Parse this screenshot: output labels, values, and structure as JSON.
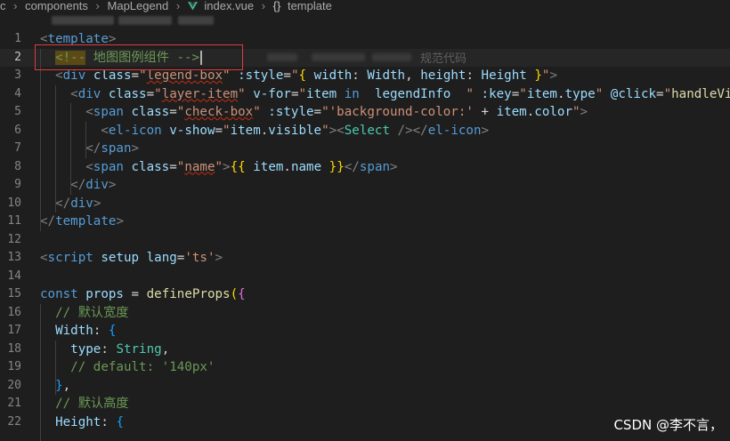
{
  "breadcrumb": {
    "items": [
      "c",
      "components",
      "MapLegend",
      "index.vue",
      "template"
    ],
    "vue_icon": "vue-logo-icon",
    "symbol_icon": "braces-icon"
  },
  "annotation": "规范代码",
  "watermark": "CSDN @李不言，",
  "colors": {
    "background": "#1e1e1e",
    "highlight_box": "#e03b3b",
    "comment_highlight": "#5c4a16"
  },
  "editor": {
    "current_line": 2,
    "lines": [
      {
        "n": "1",
        "tokens": [
          {
            "t": "<",
            "c": "t-tag"
          },
          {
            "t": "template",
            "c": "t-tn"
          },
          {
            "t": ">",
            "c": "t-tag"
          }
        ]
      },
      {
        "n": "2",
        "tokens": [
          {
            "t": "  "
          },
          {
            "t": "<!--",
            "c": "cmt-hl"
          },
          {
            "t": " 地图图例组件 -->",
            "c": "t-cmt"
          }
        ]
      },
      {
        "n": "3",
        "tokens": [
          {
            "t": "  "
          },
          {
            "t": "<",
            "c": "t-tag"
          },
          {
            "t": "div",
            "c": "t-tn"
          },
          {
            "t": " "
          },
          {
            "t": "class",
            "c": "t-attr"
          },
          {
            "t": "="
          },
          {
            "t": "\"",
            "c": "t-str"
          },
          {
            "t": "legend-box",
            "c": "t-str u-red"
          },
          {
            "t": "\"",
            "c": "t-str"
          },
          {
            "t": " "
          },
          {
            "t": ":style",
            "c": "t-attr"
          },
          {
            "t": "="
          },
          {
            "t": "\"",
            "c": "t-str"
          },
          {
            "t": "{",
            "c": "t-br1"
          },
          {
            "t": " "
          },
          {
            "t": "width",
            "c": "t-var"
          },
          {
            "t": ": "
          },
          {
            "t": "Width",
            "c": "t-var"
          },
          {
            "t": ", "
          },
          {
            "t": "height",
            "c": "t-var"
          },
          {
            "t": ": "
          },
          {
            "t": "Height",
            "c": "t-var"
          },
          {
            "t": " "
          },
          {
            "t": "}",
            "c": "t-br1"
          },
          {
            "t": "\"",
            "c": "t-str"
          },
          {
            "t": ">",
            "c": "t-tag"
          }
        ]
      },
      {
        "n": "4",
        "tokens": [
          {
            "t": "    "
          },
          {
            "t": "<",
            "c": "t-tag"
          },
          {
            "t": "div",
            "c": "t-tn"
          },
          {
            "t": " "
          },
          {
            "t": "class",
            "c": "t-attr"
          },
          {
            "t": "="
          },
          {
            "t": "\"",
            "c": "t-str"
          },
          {
            "t": "layer-item",
            "c": "t-str u-red"
          },
          {
            "t": "\"",
            "c": "t-str"
          },
          {
            "t": " "
          },
          {
            "t": "v-for",
            "c": "t-attr"
          },
          {
            "t": "="
          },
          {
            "t": "\"",
            "c": "t-str"
          },
          {
            "t": "item",
            "c": "t-var"
          },
          {
            "t": " "
          },
          {
            "t": "in",
            "c": "t-kw"
          },
          {
            "t": "  "
          },
          {
            "t": "legendInfo",
            "c": "t-var"
          },
          {
            "t": "  "
          },
          {
            "t": "\"",
            "c": "t-str"
          },
          {
            "t": " "
          },
          {
            "t": ":key",
            "c": "t-attr"
          },
          {
            "t": "="
          },
          {
            "t": "\"",
            "c": "t-str"
          },
          {
            "t": "item",
            "c": "t-var"
          },
          {
            "t": "."
          },
          {
            "t": "type",
            "c": "t-var"
          },
          {
            "t": "\"",
            "c": "t-str"
          },
          {
            "t": " "
          },
          {
            "t": "@click",
            "c": "t-attr"
          },
          {
            "t": "="
          },
          {
            "t": "\"",
            "c": "t-str"
          },
          {
            "t": "handleVisib",
            "c": "t-fn"
          }
        ]
      },
      {
        "n": "5",
        "tokens": [
          {
            "t": "      "
          },
          {
            "t": "<",
            "c": "t-tag"
          },
          {
            "t": "span",
            "c": "t-tn"
          },
          {
            "t": " "
          },
          {
            "t": "class",
            "c": "t-attr"
          },
          {
            "t": "="
          },
          {
            "t": "\"",
            "c": "t-str"
          },
          {
            "t": "check-box",
            "c": "t-str u-red"
          },
          {
            "t": "\"",
            "c": "t-str"
          },
          {
            "t": " "
          },
          {
            "t": ":style",
            "c": "t-attr"
          },
          {
            "t": "="
          },
          {
            "t": "\"",
            "c": "t-str"
          },
          {
            "t": "'background-color:'",
            "c": "t-str"
          },
          {
            "t": " + "
          },
          {
            "t": "item",
            "c": "t-var"
          },
          {
            "t": "."
          },
          {
            "t": "color",
            "c": "t-var"
          },
          {
            "t": "\"",
            "c": "t-str"
          },
          {
            "t": ">",
            "c": "t-tag"
          }
        ]
      },
      {
        "n": "6",
        "tokens": [
          {
            "t": "        "
          },
          {
            "t": "<",
            "c": "t-tag"
          },
          {
            "t": "el-icon",
            "c": "t-tn"
          },
          {
            "t": " "
          },
          {
            "t": "v-show",
            "c": "t-attr"
          },
          {
            "t": "="
          },
          {
            "t": "\"",
            "c": "t-str"
          },
          {
            "t": "item",
            "c": "t-var"
          },
          {
            "t": "."
          },
          {
            "t": "visible",
            "c": "t-var"
          },
          {
            "t": "\"",
            "c": "t-str"
          },
          {
            "t": "><",
            "c": "t-tag"
          },
          {
            "t": "Select",
            "c": "t-type"
          },
          {
            "t": " "
          },
          {
            "t": "/></",
            "c": "t-tag"
          },
          {
            "t": "el-icon",
            "c": "t-tn"
          },
          {
            "t": ">",
            "c": "t-tag"
          }
        ]
      },
      {
        "n": "7",
        "tokens": [
          {
            "t": "      "
          },
          {
            "t": "</",
            "c": "t-tag"
          },
          {
            "t": "span",
            "c": "t-tn"
          },
          {
            "t": ">",
            "c": "t-tag"
          }
        ]
      },
      {
        "n": "8",
        "tokens": [
          {
            "t": "      "
          },
          {
            "t": "<",
            "c": "t-tag"
          },
          {
            "t": "span",
            "c": "t-tn"
          },
          {
            "t": " "
          },
          {
            "t": "class",
            "c": "t-attr"
          },
          {
            "t": "="
          },
          {
            "t": "\"",
            "c": "t-str"
          },
          {
            "t": "name",
            "c": "t-str u-red"
          },
          {
            "t": "\"",
            "c": "t-str"
          },
          {
            "t": ">",
            "c": "t-tag"
          },
          {
            "t": "{{",
            "c": "t-br1"
          },
          {
            "t": " "
          },
          {
            "t": "item",
            "c": "t-var"
          },
          {
            "t": "."
          },
          {
            "t": "name",
            "c": "t-var"
          },
          {
            "t": " "
          },
          {
            "t": "}}",
            "c": "t-br1"
          },
          {
            "t": "</",
            "c": "t-tag"
          },
          {
            "t": "span",
            "c": "t-tn"
          },
          {
            "t": ">",
            "c": "t-tag"
          }
        ]
      },
      {
        "n": "9",
        "tokens": [
          {
            "t": "    "
          },
          {
            "t": "</",
            "c": "t-tag"
          },
          {
            "t": "div",
            "c": "t-tn"
          },
          {
            "t": ">",
            "c": "t-tag"
          }
        ]
      },
      {
        "n": "10",
        "tokens": [
          {
            "t": "  "
          },
          {
            "t": "</",
            "c": "t-tag"
          },
          {
            "t": "div",
            "c": "t-tn"
          },
          {
            "t": ">",
            "c": "t-tag"
          }
        ]
      },
      {
        "n": "11",
        "tokens": [
          {
            "t": "</",
            "c": "t-tag"
          },
          {
            "t": "template",
            "c": "t-tn"
          },
          {
            "t": ">",
            "c": "t-tag"
          }
        ]
      },
      {
        "n": "12",
        "tokens": []
      },
      {
        "n": "13",
        "tokens": [
          {
            "t": "<",
            "c": "t-tag"
          },
          {
            "t": "script",
            "c": "t-tn"
          },
          {
            "t": " "
          },
          {
            "t": "setup",
            "c": "t-attr"
          },
          {
            "t": " "
          },
          {
            "t": "lang",
            "c": "t-attr"
          },
          {
            "t": "="
          },
          {
            "t": "'ts'",
            "c": "t-str"
          },
          {
            "t": ">",
            "c": "t-tag"
          }
        ]
      },
      {
        "n": "14",
        "tokens": []
      },
      {
        "n": "15",
        "tokens": [
          {
            "t": "const",
            "c": "t-kw"
          },
          {
            "t": " "
          },
          {
            "t": "props",
            "c": "t-var"
          },
          {
            "t": " = "
          },
          {
            "t": "defineProps",
            "c": "t-fn"
          },
          {
            "t": "(",
            "c": "t-br1"
          },
          {
            "t": "{",
            "c": "t-br2"
          }
        ]
      },
      {
        "n": "16",
        "tokens": [
          {
            "t": "  "
          },
          {
            "t": "// 默认宽度",
            "c": "t-cmt"
          }
        ]
      },
      {
        "n": "17",
        "tokens": [
          {
            "t": "  "
          },
          {
            "t": "Width",
            "c": "t-var"
          },
          {
            "t": ": "
          },
          {
            "t": "{",
            "c": "t-br3"
          }
        ]
      },
      {
        "n": "18",
        "tokens": [
          {
            "t": "    "
          },
          {
            "t": "type",
            "c": "t-var"
          },
          {
            "t": ": "
          },
          {
            "t": "String",
            "c": "t-type"
          },
          {
            "t": ","
          }
        ]
      },
      {
        "n": "19",
        "tokens": [
          {
            "t": "    "
          },
          {
            "t": "// default: '140px'",
            "c": "t-cmt"
          }
        ]
      },
      {
        "n": "20",
        "tokens": [
          {
            "t": "  "
          },
          {
            "t": "}",
            "c": "t-br3"
          },
          {
            "t": ","
          }
        ]
      },
      {
        "n": "21",
        "tokens": [
          {
            "t": "  "
          },
          {
            "t": "// 默认高度",
            "c": "t-cmt"
          }
        ]
      },
      {
        "n": "22",
        "tokens": [
          {
            "t": "  "
          },
          {
            "t": "Height",
            "c": "t-var"
          },
          {
            "t": ": "
          },
          {
            "t": "{",
            "c": "t-br3"
          }
        ]
      }
    ]
  }
}
